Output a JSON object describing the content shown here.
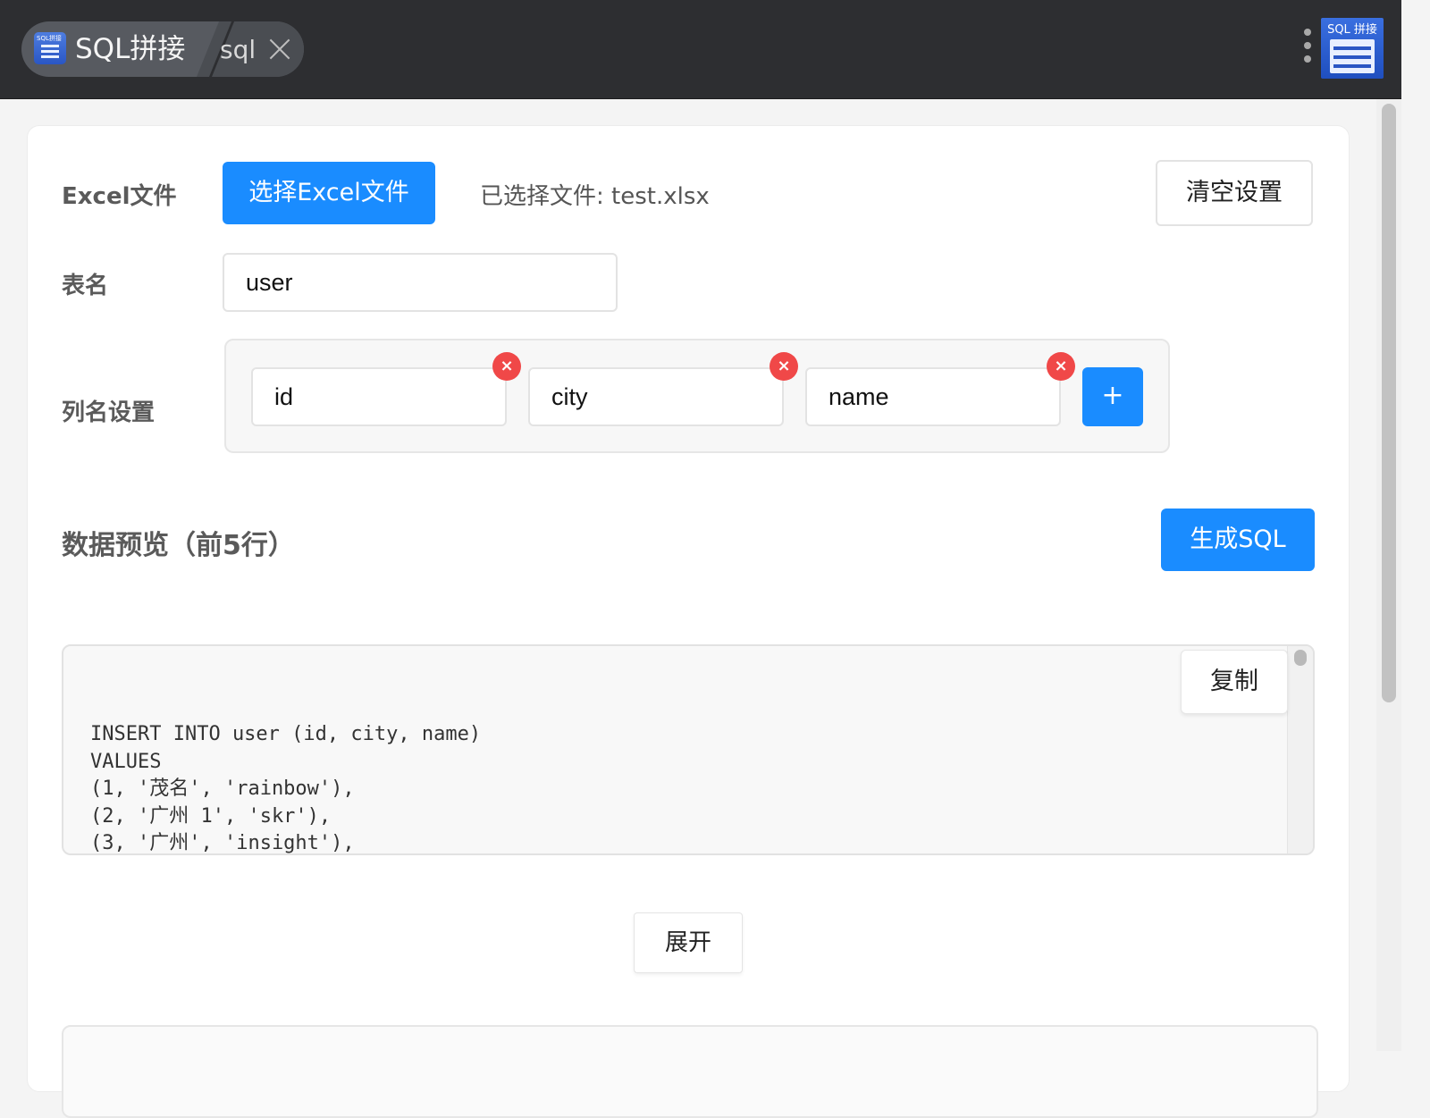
{
  "window": {
    "tab_title": "SQL拼接",
    "tab_subtitle": "sql",
    "logo_text": "SQL 拼接",
    "icon_small_text": "SQL拼接"
  },
  "form": {
    "excel_label": "Excel文件",
    "choose_button": "选择Excel文件",
    "selected_file_text": "已选择文件: test.xlsx",
    "clear_button": "清空设置",
    "table_label": "表名",
    "table_name_value": "user",
    "columns_label": "列名设置",
    "columns": [
      "id",
      "city",
      "name"
    ],
    "add_column_button": "+",
    "delete_column_icon_glyph": "×"
  },
  "preview": {
    "title": "数据预览（前5行）",
    "generate_button": "生成SQL",
    "copy_button": "复制",
    "sql_text": "INSERT INTO user (id, city, name)\nVALUES\n(1, '茂名', 'rainbow'),\n(2, '广州 1', 'skr'),\n(3, '广州', 'insight'),",
    "expand_button": "展开"
  },
  "colors": {
    "primary": "#1a8cff",
    "danger": "#f04848",
    "titlebar": "#2d2e31"
  }
}
